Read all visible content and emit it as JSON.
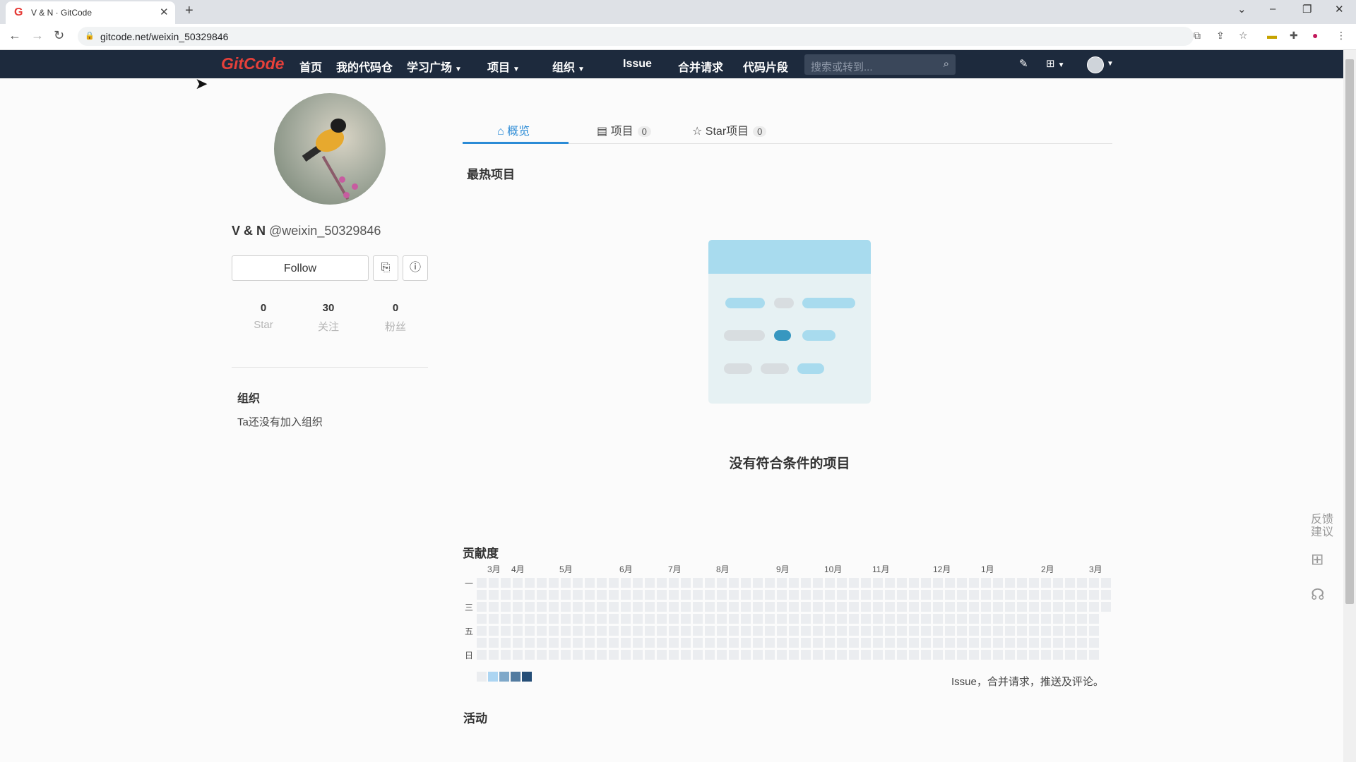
{
  "browser": {
    "tab_title": "V & N · GitCode",
    "favicon": "G",
    "url": "gitcode.net/weixin_50329846"
  },
  "header": {
    "logo": "GitCode",
    "nav": [
      "首页",
      "我的代码仓",
      "学习广场",
      "项目",
      "组织",
      "Issue",
      "合并请求",
      "代码片段"
    ],
    "search_placeholder": "搜索或转到..."
  },
  "profile": {
    "display_name": "V & N",
    "handle": "@weixin_50329846",
    "follow_label": "Follow",
    "stats": [
      {
        "value": "0",
        "label": "Star"
      },
      {
        "value": "30",
        "label": "关注"
      },
      {
        "value": "0",
        "label": "粉丝"
      }
    ],
    "org_title": "组织",
    "org_empty": "Ta还没有加入组织"
  },
  "tabs": [
    {
      "label": "概览",
      "count": ""
    },
    {
      "label": "项目",
      "count": "0"
    },
    {
      "label": "Star项目",
      "count": "0"
    }
  ],
  "hot_projects": {
    "title": "最热项目",
    "empty_text": "没有符合条件的项目"
  },
  "contribution": {
    "title": "贡献度",
    "months": [
      "3月",
      "4月",
      "5月",
      "6月",
      "7月",
      "8月",
      "9月",
      "10月",
      "11月",
      "12月",
      "1月",
      "2月",
      "3月"
    ],
    "weekdays": [
      "一",
      "三",
      "五",
      "日"
    ],
    "legend_colors": [
      "#ebedf0",
      "#acd5f2",
      "#7fa8c9",
      "#527ba0",
      "#254e77"
    ],
    "description": "Issue，合并请求，推送及评论。"
  },
  "activity": {
    "title": "活动"
  },
  "side_widgets": {
    "feedback": "反馈\n建议"
  },
  "colors": {
    "header_bg": "#1d2a3d",
    "accent": "#2b8bd6",
    "logo": "#e6403a"
  }
}
